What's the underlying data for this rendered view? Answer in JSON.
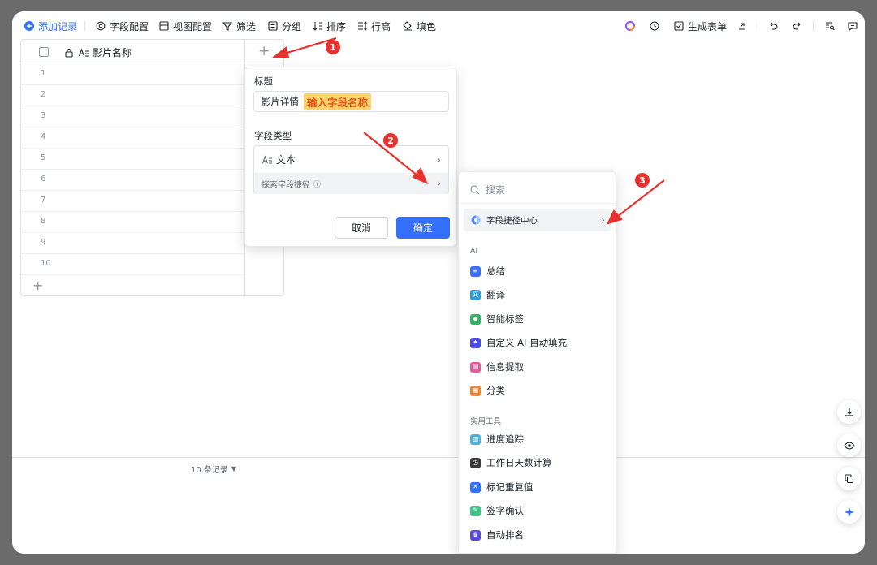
{
  "toolbar": {
    "add_record": "添加记录",
    "field_config": "字段配置",
    "view_config": "视图配置",
    "filter": "筛选",
    "group": "分组",
    "sort": "排序",
    "row_height": "行高",
    "fill_color": "填色",
    "generate_form": "生成表单"
  },
  "grid": {
    "column_title": "影片名称",
    "rows": [
      "1",
      "2",
      "3",
      "4",
      "5",
      "6",
      "7",
      "8",
      "9",
      "10"
    ],
    "record_count": "10 条记录"
  },
  "field_panel": {
    "title_label": "标题",
    "title_value": "影片详情",
    "title_highlight": "输入字段名称",
    "type_label": "字段类型",
    "type_value": "文本",
    "shortcut_label": "探索字段捷径",
    "cancel": "取消",
    "confirm": "确定"
  },
  "menu": {
    "search_placeholder": "搜索",
    "hub": "字段捷径中心",
    "section_ai": "AI",
    "ai_items": [
      {
        "label": "总结",
        "color": "#3b6ef5"
      },
      {
        "label": "翻译",
        "color": "#2fa0d8"
      },
      {
        "label": "智能标签",
        "color": "#34b062"
      },
      {
        "label": "自定义 AI 自动填充",
        "color": "#4d4adf"
      },
      {
        "label": "信息提取",
        "color": "#e35a9a"
      },
      {
        "label": "分类",
        "color": "#f0852d"
      }
    ],
    "section_tools": "实用工具",
    "tool_items": [
      {
        "label": "进度追踪",
        "color": "#4fb3d9"
      },
      {
        "label": "工作日天数计算",
        "color": "#3a3a3a"
      },
      {
        "label": "标记重复值",
        "color": "#3370ff"
      },
      {
        "label": "签字确认",
        "color": "#3fc48c"
      },
      {
        "label": "自动排名",
        "color": "#5b4bdb"
      }
    ]
  },
  "annotations": [
    "1",
    "2",
    "3"
  ],
  "colors": {
    "accent": "#3370ff",
    "annotation": "#e8322d",
    "highlight": "#ffd36b"
  }
}
